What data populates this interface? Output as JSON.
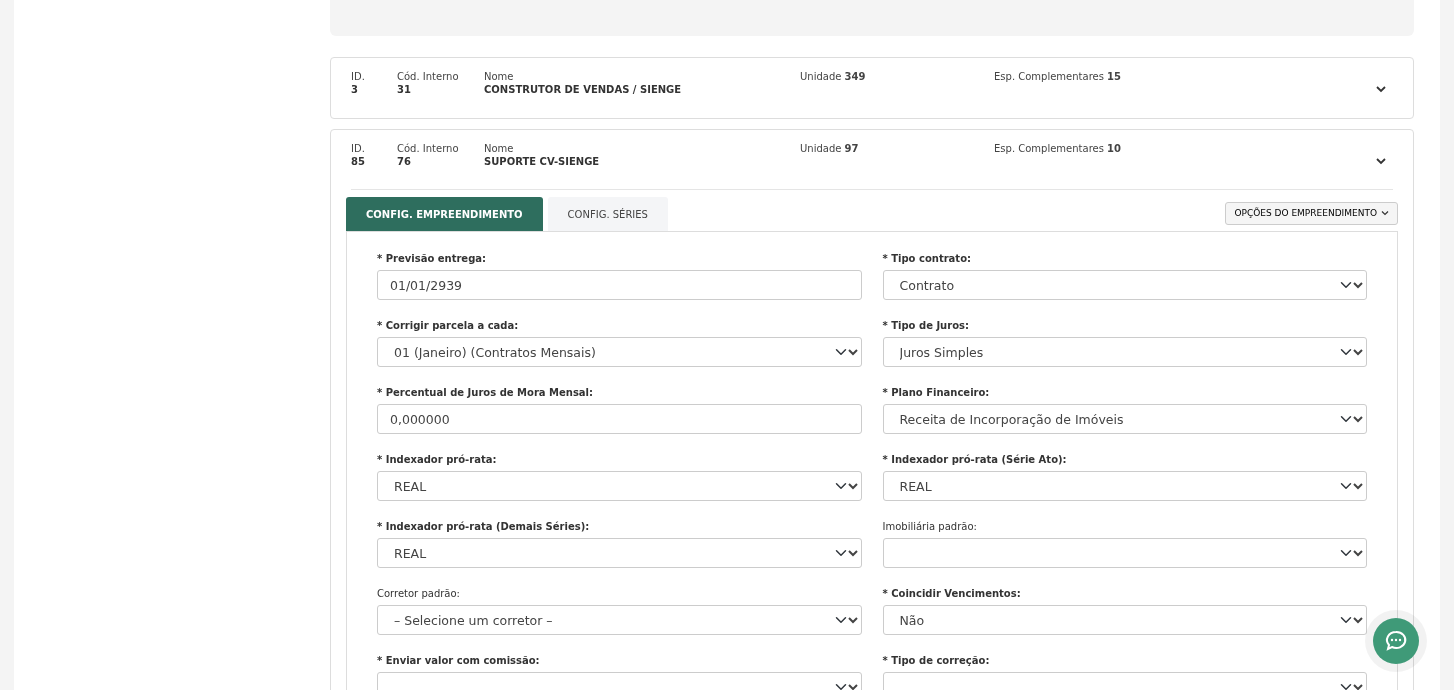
{
  "records": [
    {
      "id_label": "ID.",
      "id": "3",
      "code_label": "Cód. Interno",
      "code": "31",
      "name_label": "Nome",
      "name": "CONSTRUTOR DE VENDAS / SIENGE",
      "unit_label": "Unidade",
      "unit": "349",
      "extra_label": "Esp. Complementares",
      "extra": "15",
      "expanded": false
    },
    {
      "id_label": "ID.",
      "id": "85",
      "code_label": "Cód. Interno",
      "code": "76",
      "name_label": "Nome",
      "name": "SUPORTE CV-SIENGE",
      "unit_label": "Unidade",
      "unit": "97",
      "extra_label": "Esp. Complementares",
      "extra": "10",
      "expanded": true
    }
  ],
  "tabs": [
    {
      "label": "CONFIG. EMPREENDIMENTO",
      "selected": true
    },
    {
      "label": "CONFIG. SÉRIES",
      "selected": false
    }
  ],
  "options_button": "OPÇÕES DO EMPREENDIMENTO",
  "fields": [
    {
      "label": "* Previsão entrega:",
      "required": true,
      "kind": "input",
      "value": "01/01/2939"
    },
    {
      "label": "* Tipo contrato:",
      "required": true,
      "kind": "select",
      "value": "Contrato"
    },
    {
      "label": "* Corrigir parcela a cada:",
      "required": true,
      "kind": "select",
      "value": "01 (Janeiro) (Contratos Mensais)"
    },
    {
      "label": "* Tipo de Juros:",
      "required": true,
      "kind": "select",
      "value": "Juros Simples"
    },
    {
      "label": "* Percentual de Juros de Mora Mensal:",
      "required": true,
      "kind": "input",
      "value": "0,000000"
    },
    {
      "label": "* Plano Financeiro:",
      "required": true,
      "kind": "select",
      "value": "Receita de Incorporação de Imóveis"
    },
    {
      "label": "* Indexador pró-rata:",
      "required": true,
      "kind": "select",
      "value": "REAL"
    },
    {
      "label": "* Indexador pró-rata (Série Ato):",
      "required": true,
      "kind": "select",
      "value": "REAL"
    },
    {
      "label": "* Indexador pró-rata (Demais Séries):",
      "required": true,
      "kind": "select",
      "value": "REAL"
    },
    {
      "label": "Imobiliária padrão:",
      "required": false,
      "kind": "select"
    },
    {
      "label": "Corretor padrão:",
      "required": false,
      "kind": "select",
      "value": "– Selecione um corretor –"
    },
    {
      "label": "* Coincidir Vencimentos:",
      "required": true,
      "kind": "select",
      "value": "Não"
    },
    {
      "label": "* Enviar valor com comissão:",
      "required": true,
      "kind": "select"
    },
    {
      "label": "* Tipo de correção:",
      "required": true,
      "kind": "select"
    }
  ]
}
